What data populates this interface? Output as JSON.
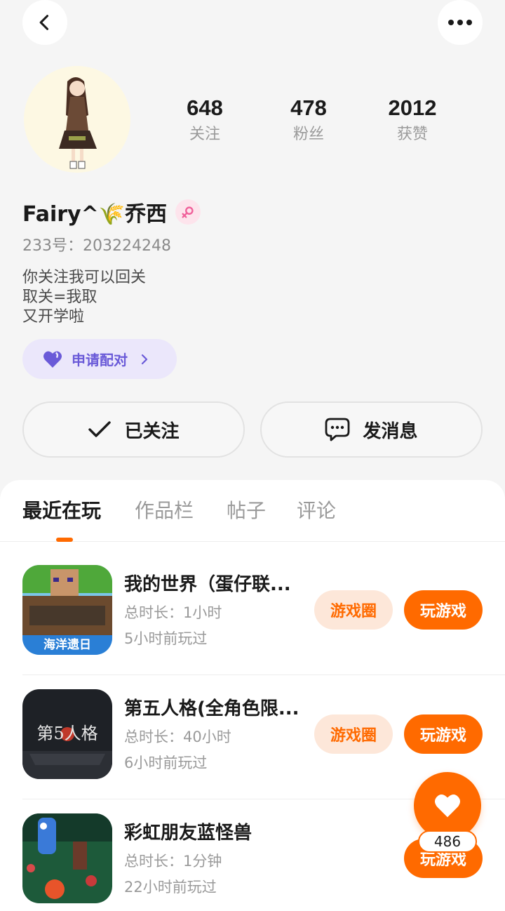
{
  "header": {
    "back_icon": "chevron-left-icon",
    "more_icon": "more-horizontal-icon"
  },
  "profile": {
    "avatar": "avatar-girl-illustration",
    "name": "Fairy^🌾乔西",
    "gender_icon": "female-icon",
    "uid": "233号：203224248",
    "bio_lines": [
      "你关注我可以回关",
      "取关=我取",
      "又开学啦"
    ],
    "stats": [
      {
        "value": "648",
        "label": "关注"
      },
      {
        "value": "478",
        "label": "粉丝"
      },
      {
        "value": "2012",
        "label": "获赞"
      }
    ],
    "match_button": {
      "label": "申请配对",
      "icon": "heart-icon"
    },
    "follow_button": {
      "label": "已关注",
      "icon": "check-icon"
    },
    "message_button": {
      "label": "发消息",
      "icon": "chat-bubble-icon"
    }
  },
  "tabs": [
    {
      "label": "最近在玩",
      "active": true
    },
    {
      "label": "作品栏",
      "active": false
    },
    {
      "label": "帖子",
      "active": false
    },
    {
      "label": "评论",
      "active": false
    }
  ],
  "games": [
    {
      "title": "我的世界（蛋仔联...",
      "duration": "总时长：1小时",
      "last_played": "5小时前玩过",
      "circle_label": "游戏圈",
      "play_label": "玩游戏",
      "icon_caption": "海洋遗日"
    },
    {
      "title": "第五人格(全角色限...",
      "duration": "总时长：40小时",
      "last_played": "6小时前玩过",
      "circle_label": "游戏圈",
      "play_label": "玩游戏",
      "icon_caption": "第5人格"
    },
    {
      "title": "彩虹朋友蓝怪兽",
      "duration": "总时长：1分钟",
      "last_played": "22小时前玩过",
      "play_label": "玩游戏"
    }
  ],
  "like_fab": {
    "icon": "heart-icon",
    "count": "486"
  },
  "colors": {
    "accent": "#ff6a00",
    "accent_light": "#fde7d9",
    "match_bg": "#ebe7fb",
    "match_fg": "#6a5ad8",
    "female_badge": "#fde4ec"
  }
}
